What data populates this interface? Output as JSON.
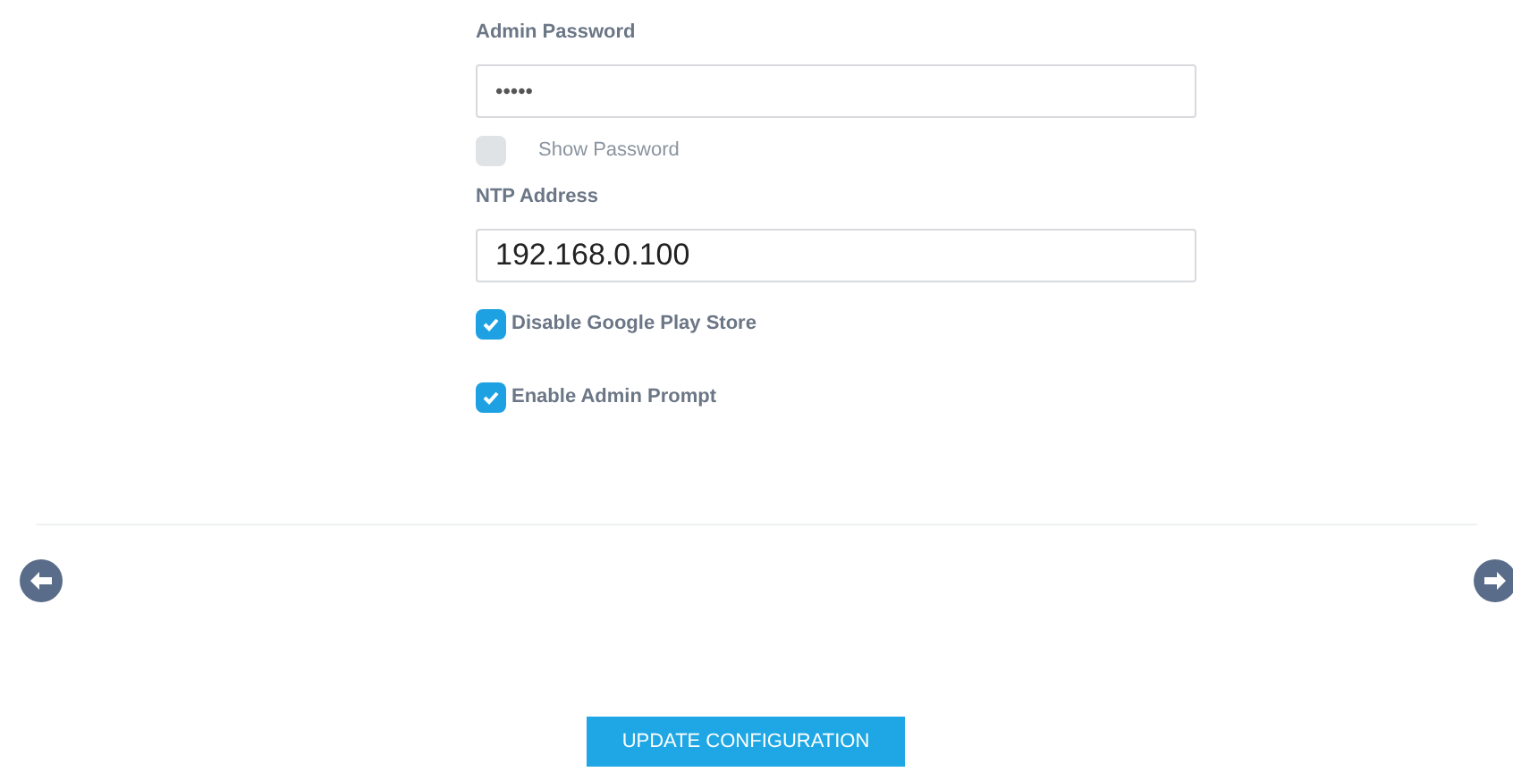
{
  "admin_password": {
    "label": "Admin Password",
    "value": "•••••"
  },
  "show_password": {
    "label": "Show Password",
    "checked": false
  },
  "ntp_address": {
    "label": "NTP Address",
    "value": "192.168.0.100"
  },
  "options": [
    {
      "label": "Disable Google Play Store",
      "checked": true
    },
    {
      "label": "Enable Admin Prompt",
      "checked": true
    }
  ],
  "update_button": "UPDATE CONFIGURATION"
}
